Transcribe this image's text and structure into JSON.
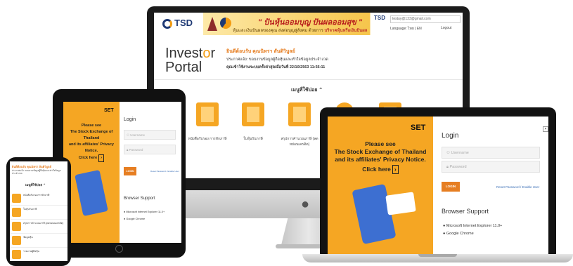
{
  "imac": {
    "brand": "TSD",
    "slogan": "\" ปันหุ้นออมบุญ ปันผลออมสุข \"",
    "slogan_sub_1": "หุ้นและเงินปันผลของคุณ ส่งต่อบุญสู่สังคม ด้วยการ ",
    "slogan_sub_2": "บริจาคหุ้นหรือเงินปันผล",
    "brand_small": "TSD",
    "email": "testuy@123@gmail.com",
    "language": "Language: ไทย | EN",
    "logout": "Logout",
    "portal_title_1": "Invest",
    "portal_title_o": "o",
    "portal_title_2": "r",
    "portal_title_3": "Portal",
    "welcome": "ยินดีต้อนรับ คุณนิทรา สันติวิบูลย์",
    "announce": "ประกาศแจ้ง: ขอบงานข้อมูลผู้ถือหุ้นและทำใจข้อมูลประจำงวด",
    "last_login": "คุณเข้าใช้งานระบบครั้งล่าสุดเมื่อวันที่ 22/10/2563 11:56:11",
    "menu_heading": "เมนูที่ใช้บ่อย",
    "tiles": [
      {
        "label": "หนังสือรับรอง การหักภาษี",
        "icon": "tax"
      },
      {
        "label": "ใบหุ้นรับภาษี",
        "icon": "e-filing"
      },
      {
        "label": "สรุปการคำนวณภาษี (ลดหย่อนเครดิต)",
        "icon": "tax-percent"
      },
      {
        "label": "",
        "icon": "document"
      },
      {
        "label": "",
        "icon": "report"
      }
    ]
  },
  "ipad": {
    "set_logo": "SET",
    "notice_1": "Please see",
    "notice_2": "The Stock Exchange of Thailand",
    "notice_3": "and its affiliates' Privacy Notice.",
    "click_here": "Click here",
    "login_heading": "Login",
    "username_placeholder": "Username",
    "password_placeholder": "Password",
    "login_button": "LOGIN",
    "reset_link": "Reset Password / Enable User",
    "browser_support": "Browser Support",
    "browser_ie": "Microsoft Internet Explorer 11.0+",
    "browser_chrome": "Google Chrome"
  },
  "macbook": {
    "set_logo": "SET",
    "notice_1": "Please see",
    "notice_2": "The Stock Exchange of Thailand",
    "notice_3": "and its affiliates' Privacy Notice.",
    "click_here": "Click here",
    "login_heading": "Login",
    "username_placeholder": "Username",
    "password_placeholder": "Password",
    "login_button": "LOGIN",
    "reset_link": "Reset Password / Enable User",
    "browser_support": "Browser Support",
    "browser_ie": "Microsoft Internet Explorer 11.0+",
    "browser_chrome": "Google Chrome"
  },
  "iphone": {
    "welcome": "ยินดีต้อนรับ คุณนิทรา สันติวิบูลย์",
    "announce": "ประกาศแจ้ง: ขอบงานข้อมูลผู้ถือหุ้นและทำใจข้อมูลประจำงวด",
    "menu_heading": "เมนูที่ใช้บ่อย",
    "items": [
      "หนังสือรับรองการหักภาษี",
      "ใบหุ้นรับภาษี",
      "สรุปการคำนวณภาษี (ลดหย่อนเครดิต)",
      "ข้อมูลหุ้น",
      "รายงานผู้ถือหุ้น"
    ]
  },
  "colors": {
    "accent": "#f5a623",
    "brand_blue": "#1f3a75",
    "button": "#e67e22"
  }
}
